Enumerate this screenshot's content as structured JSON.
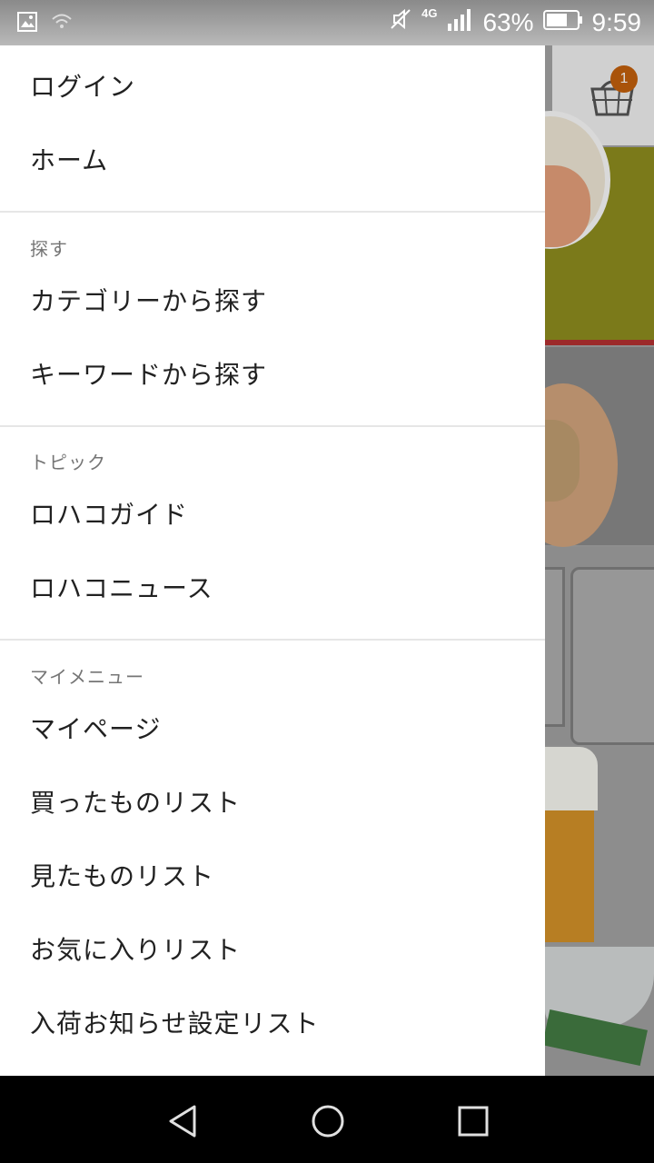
{
  "status_bar": {
    "network": "4G",
    "battery": "63%",
    "time": "9:59"
  },
  "cart": {
    "badge_count": "1"
  },
  "drawer": {
    "top_items": [
      {
        "label": "ログイン"
      },
      {
        "label": "ホーム"
      }
    ],
    "sections": [
      {
        "title": "探す",
        "items": [
          {
            "label": "カテゴリーから探す"
          },
          {
            "label": "キーワードから探す"
          }
        ]
      },
      {
        "title": "トピック",
        "items": [
          {
            "label": "ロハコガイド"
          },
          {
            "label": "ロハコニュース"
          }
        ]
      },
      {
        "title": "マイメニュー",
        "items": [
          {
            "label": "マイページ"
          },
          {
            "label": "買ったものリスト"
          },
          {
            "label": "見たものリスト"
          },
          {
            "label": "お気に入りリスト"
          },
          {
            "label": "入荷お知らせ設定リスト"
          }
        ]
      }
    ]
  },
  "colors": {
    "badge": "#a9530a",
    "drawer_bg": "#ffffff",
    "text": "#212121",
    "section_label": "#757575"
  }
}
